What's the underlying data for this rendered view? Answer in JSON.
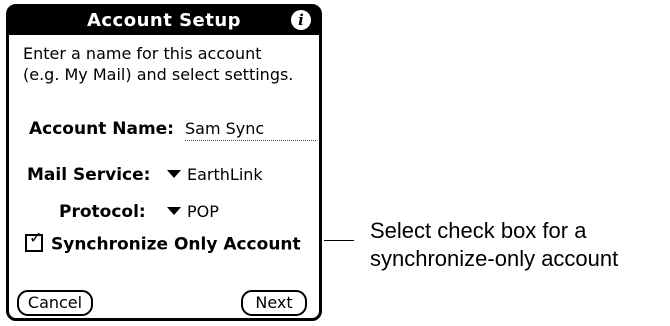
{
  "dialog": {
    "title": "Account Setup",
    "info_glyph": "i",
    "instructions_line1": "Enter a name for this account",
    "instructions_line2": "(e.g. My Mail) and select settings."
  },
  "account_name": {
    "label": "Account Name:",
    "value": "Sam Sync"
  },
  "mail_service": {
    "label": "Mail Service:",
    "selected": "EarthLink"
  },
  "protocol": {
    "label": "Protocol:",
    "selected": "POP"
  },
  "sync_only": {
    "label": "Synchronize Only Account",
    "checked": true,
    "check_glyph": "✓"
  },
  "buttons": {
    "cancel": "Cancel",
    "next": "Next"
  },
  "callout": {
    "line1": "Select check box for a",
    "line2": "synchronize-only account"
  }
}
